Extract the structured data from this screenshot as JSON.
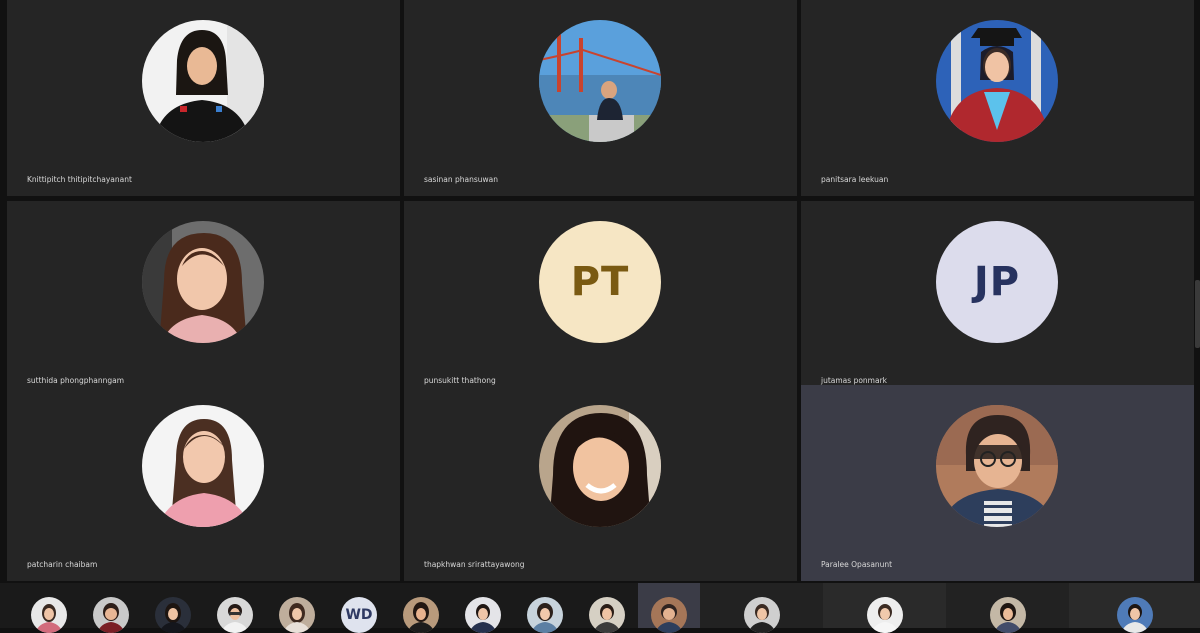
{
  "participants": [
    {
      "name": "Knittipitch thitipitchayanant",
      "type": "photo"
    },
    {
      "name": "sasinan phansuwan",
      "type": "photo"
    },
    {
      "name": "panitsara leekuan",
      "type": "photo"
    },
    {
      "name": "sutthida phongphanngam",
      "type": "photo"
    },
    {
      "name": "punsukitt thathong",
      "type": "initials",
      "initials": "PT",
      "bg": "#f6e6c4",
      "fg": "#7a5a12"
    },
    {
      "name": "jutamas ponmark",
      "type": "initials",
      "initials": "JP",
      "bg": "#dcdcec",
      "fg": "#27325f"
    },
    {
      "name": "patcharin chaibam",
      "type": "photo"
    },
    {
      "name": "thapkhwan srirattayawong",
      "type": "photo"
    },
    {
      "name": "Paralee Opasanunt",
      "type": "photo",
      "active": true
    }
  ],
  "strip": {
    "initials_thumb": "WD"
  },
  "colors": {
    "tile_bg": "#252525",
    "active_tile_bg": "#3b3c47",
    "background": "#111111"
  }
}
